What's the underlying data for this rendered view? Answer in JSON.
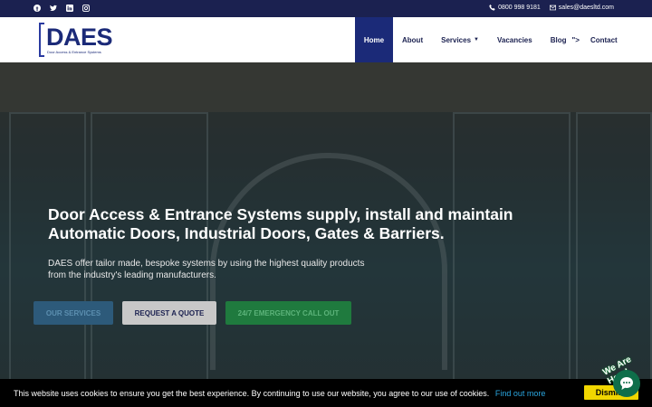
{
  "topbar": {
    "social": [
      "facebook-icon",
      "twitter-icon",
      "linkedin-icon",
      "instagram-icon"
    ],
    "phone": "0800 998 9181",
    "email": "sales@daesltd.com"
  },
  "nav": {
    "logo_word": "DAES",
    "logo_tagline": "Door Access & Entrance Systems",
    "items": [
      {
        "label": "Home"
      },
      {
        "label": "About"
      },
      {
        "label": "Services"
      },
      {
        "label": "Vacancies"
      },
      {
        "label": "Blog"
      },
      {
        "label": "\">"
      },
      {
        "label": "Contact"
      }
    ]
  },
  "hero": {
    "headline_line1": "Door Access & Entrance Systems supply, install and maintain",
    "headline_line2": "Automatic Doors, Industrial Doors, Gates & Barriers.",
    "sub_line1": "DAES offer tailor made, bespoke systems by using the highest quality products",
    "sub_line2": "from the industry's leading manufacturers.",
    "buttons": {
      "services": "OUR SERVICES",
      "quote": "REQUEST A QUOTE",
      "emergency": "24/7 EMERGENCY CALL OUT"
    }
  },
  "cookie": {
    "message": "This website uses cookies to ensure you get the best experience. By continuing to use our website, you agree to our use of cookies.",
    "link": "Find out more",
    "dismiss": "Dismiss"
  },
  "chat": {
    "label": "We Are Here!"
  },
  "colors": {
    "topbar": "#1b2150",
    "brand": "#1b2a78",
    "emergency": "#1f7a3e",
    "dismiss": "#f1d600",
    "link": "#2aa6e0"
  }
}
